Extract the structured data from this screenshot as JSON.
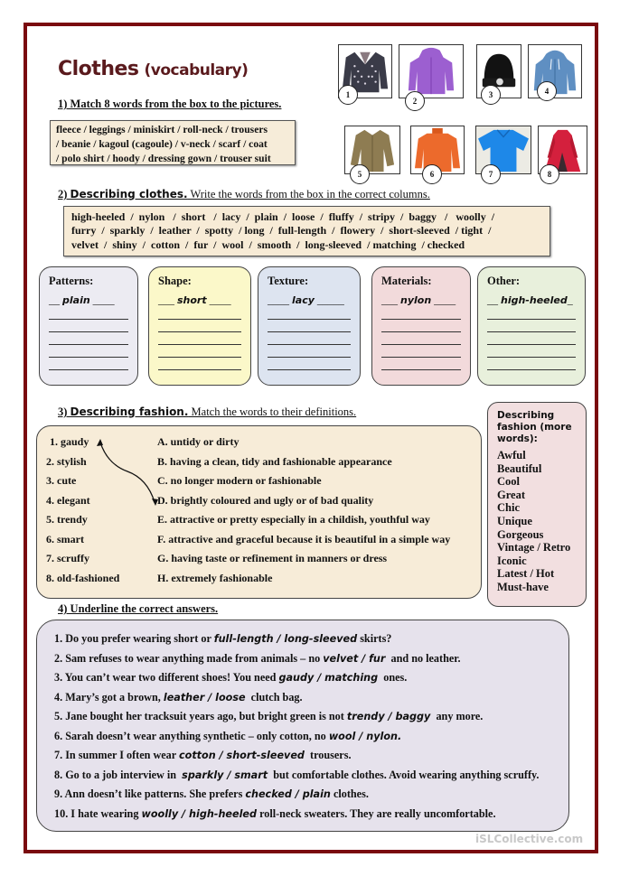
{
  "title": {
    "main": "Clothes",
    "sub": "(vocabulary)"
  },
  "section1": {
    "heading": "1) Match 8 words from the box to the pictures.",
    "box_lines": [
      "fleece  /  leggings /  miniskirt  /  roll-neck  /  trousers",
      "/  beanie /  kagoul (cagoule)  /  v-neck  / scarf  /  coat",
      "/  polo shirt  /  hoody /  dressing  gown / trouser suit"
    ],
    "pictures": [
      {
        "number": "1",
        "icon": "cardigan-icon",
        "color": "#3a3b48"
      },
      {
        "number": "2",
        "icon": "kagoul-icon",
        "color": "#9c5fd0"
      },
      {
        "number": "3",
        "icon": "beanie-icon",
        "color": "#121212"
      },
      {
        "number": "4",
        "icon": "hoody-icon",
        "color": "#5f8fc2"
      },
      {
        "number": "5",
        "icon": "fleece-icon",
        "color": "#8e7c52"
      },
      {
        "number": "6",
        "icon": "roll-neck-icon",
        "color": "#ec6a2c"
      },
      {
        "number": "7",
        "icon": "polo-shirt-icon",
        "color": "#1e88e8"
      },
      {
        "number": "8",
        "icon": "coat-icon",
        "color": "#d4203d"
      }
    ]
  },
  "section2": {
    "heading_num": "2) ",
    "heading_bold": "Describing clothes.",
    "heading_rest": " Write the words from the box in the correct columns.",
    "box_lines": [
      "high-heeled  /  nylon   /  short   /  lacy  /  plain  /  loose  /  fluffy  /  stripy  /  baggy   /   woolly  /",
      "furry  /  sparkly  /  leather  /  spotty  / long  /  full-length  /  flowery  /  short-sleeved  / tight  /",
      "velvet  /  shiny  /  cotton  /  fur  /  wool  /  smooth  /  long-sleeved  / matching  / checked"
    ],
    "columns": [
      {
        "label": "Patterns:",
        "pre": "__ ",
        "example": "plain",
        "post": " ____",
        "bg": "#ecebf2"
      },
      {
        "label": "Shape:",
        "pre": "___ ",
        "example": "short",
        "post": " ____",
        "bg": "#fbf8c9"
      },
      {
        "label": "Texture:",
        "pre": "____ ",
        "example": "lacy",
        "post": " _____",
        "bg": "#dde4f0"
      },
      {
        "label": "Materials:",
        "pre": "___ ",
        "example": "nylon",
        "post": " ____",
        "bg": "#f2dadb"
      },
      {
        "label": "Other:",
        "pre": "__ ",
        "example": "high-heeled",
        "post": "_",
        "bg": "#e8f0dc"
      }
    ]
  },
  "section3": {
    "heading_num": "3) ",
    "heading_bold": "Describing fashion.",
    "heading_rest": " Match the words to their definitions.",
    "words": [
      "1. gaudy",
      "2. stylish",
      "3. cute",
      "4. elegant",
      "5. trendy",
      "6. smart",
      "7. scruffy",
      "8. old-fashioned"
    ],
    "definitions": [
      "A. untidy or dirty",
      "B. having a clean, tidy and fashionable appearance",
      "C. no longer modern or fashionable",
      "D. brightly coloured and ugly or of bad quality",
      "E. attractive or pretty especially in a childish, youthful way",
      "F. attractive and graceful because it is beautiful in a simple way",
      "G. having taste or refinement in manners or dress",
      "H.  extremely fashionable"
    ],
    "example_match": "1 → D"
  },
  "sidebar": {
    "heading": [
      "Describing",
      "fashion (more",
      "words):"
    ],
    "words": [
      "Awful",
      "Beautiful",
      "Cool",
      "Great",
      "Chic",
      "Unique",
      "Gorgeous",
      "Vintage / Retro",
      "Iconic",
      "Latest / Hot",
      "Must-have"
    ]
  },
  "section4": {
    "heading": "4) Underline the correct answers.",
    "sentences": [
      {
        "before": "1. Do you prefer wearing short or ",
        "options": "full-length / long-sleeved",
        "after": " skirts?"
      },
      {
        "before": "2. Sam refuses to wear anything made from animals – no ",
        "options": "velvet / fur",
        "after": "  and no leather."
      },
      {
        "before": "3. You can’t wear two different shoes! You need ",
        "options": "gaudy / matching",
        "after": "  ones."
      },
      {
        "before": "4. Mary’s got a brown, ",
        "options": "leather / loose",
        "after": "  clutch bag."
      },
      {
        "before": "5. Jane bought her tracksuit years ago, but bright green is not ",
        "options": "trendy / baggy",
        "after": "  any more."
      },
      {
        "before": "6. Sarah doesn’t wear anything synthetic – only cotton, no ",
        "options": "wool / nylon.",
        "after": ""
      },
      {
        "before": "7. In summer I often wear ",
        "options": "cotton / short-sleeved",
        "after": "  trousers."
      },
      {
        "before": "8. Go to a job interview in  ",
        "options": "sparkly / smart",
        "after": "  but comfortable clothes. Avoid wearing anything scruffy."
      },
      {
        "before": "9. Ann doesn’t like patterns. She prefers ",
        "options": "checked / plain",
        "after": " clothes."
      },
      {
        "before": "10. I hate wearing ",
        "options": "woolly / high-heeled",
        "after": " roll-neck sweaters. They are really uncomfortable."
      }
    ]
  },
  "watermark": "iSLCollective.com",
  "colors": {
    "frame": "#7a0a0f",
    "title": "#5a1a1d"
  }
}
